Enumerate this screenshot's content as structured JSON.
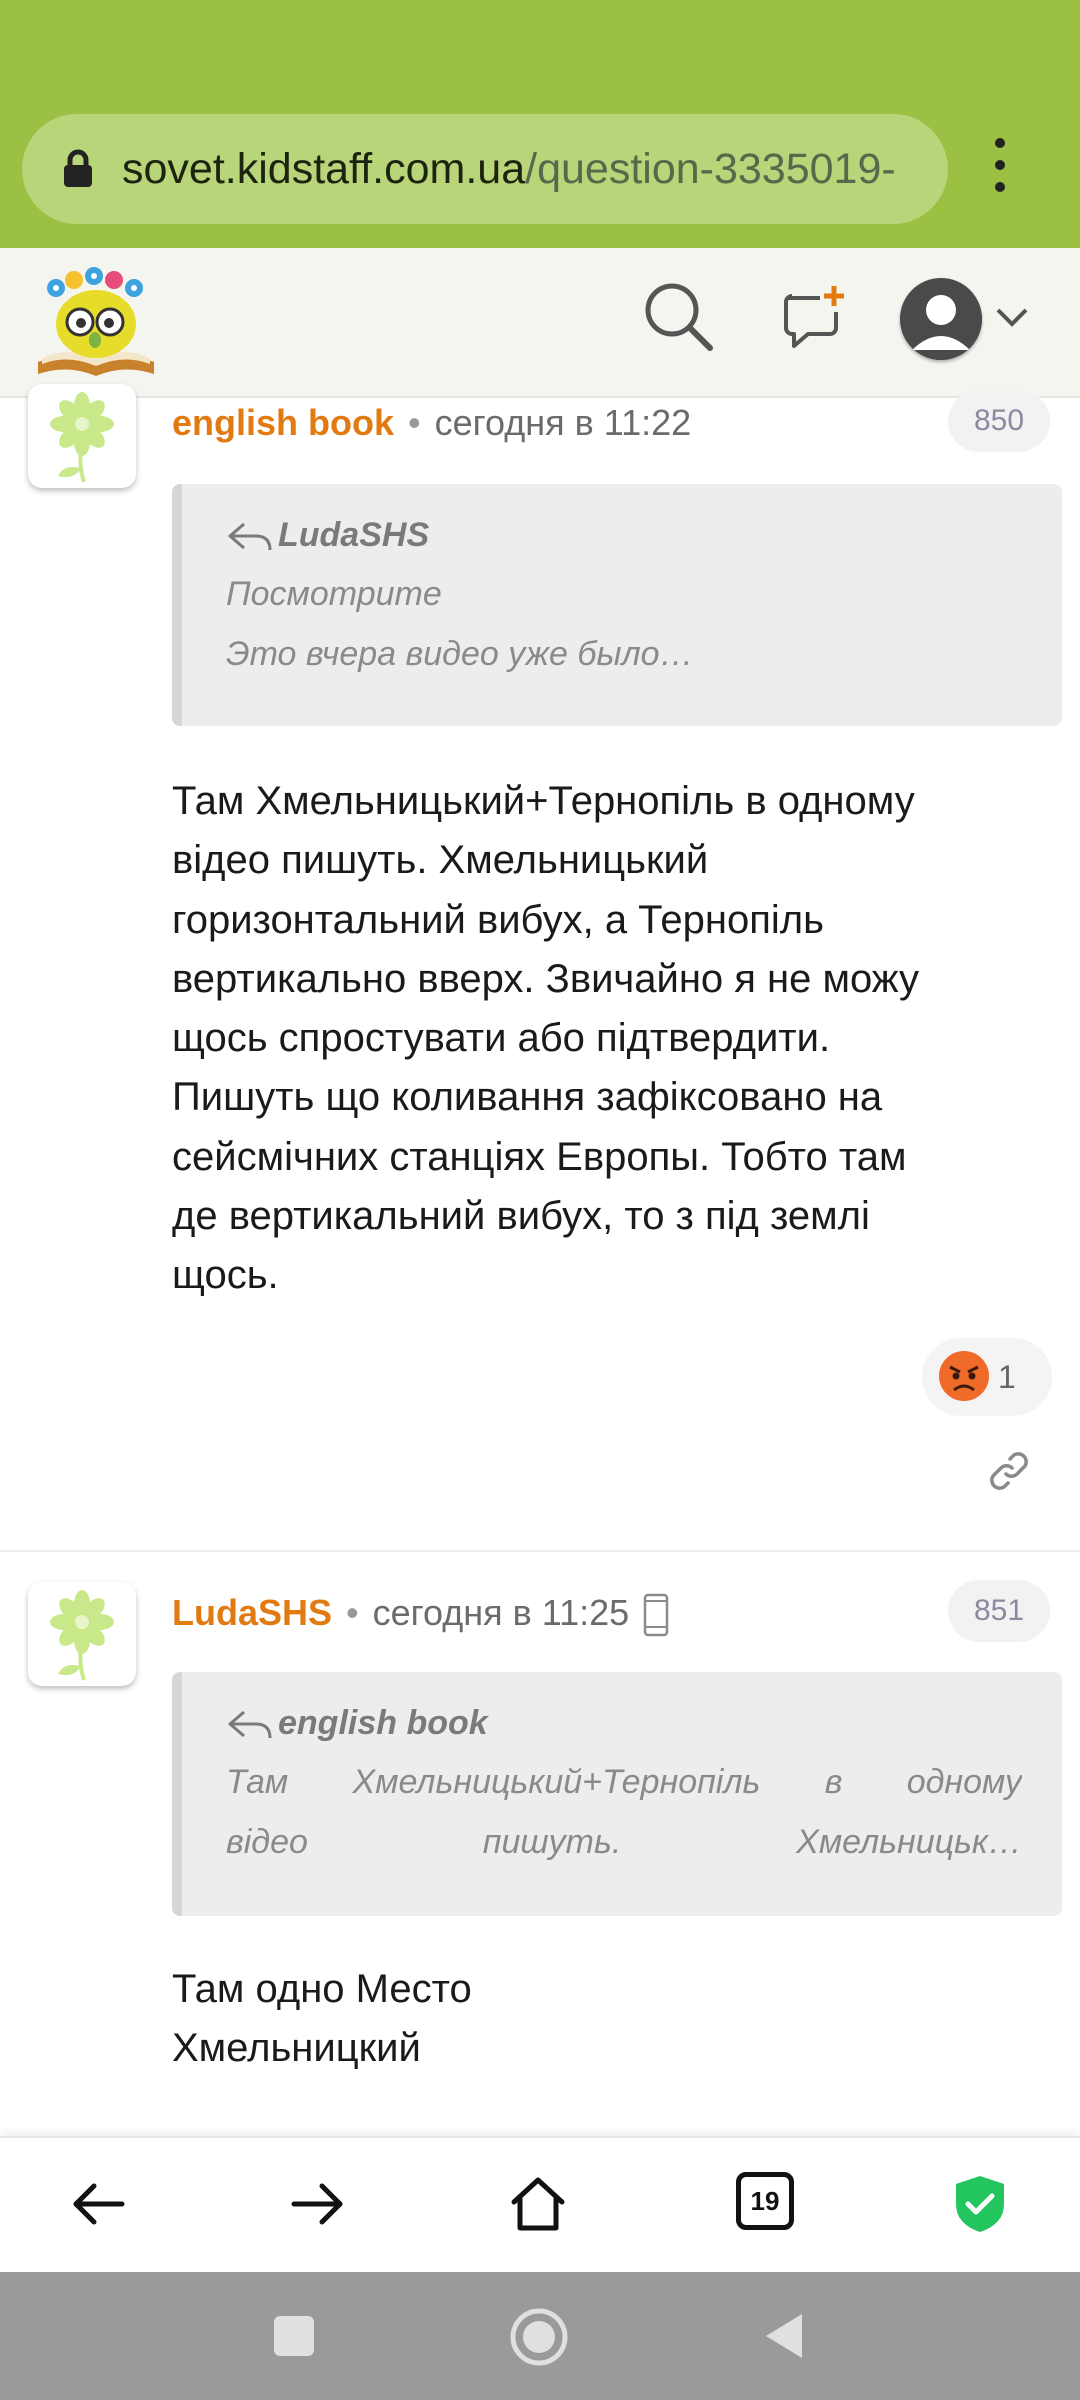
{
  "browser": {
    "url_host": "sovet.kidstaff.com.ua",
    "url_path": "/question-3335019-"
  },
  "site_header": {
    "logo_icon": "kidstaff-logo",
    "search_icon": "search-icon",
    "new_message_icon": "new-message-icon",
    "avatar_icon": "user-avatar-icon"
  },
  "posts": [
    {
      "author": "english book",
      "time": "сегодня в 11:22",
      "number": "850",
      "quote": {
        "author": "LudaSHS",
        "lines": [
          "Посмотрите",
          "Это вчера видео уже было…"
        ]
      },
      "body_lines": [
        "Там Хмельницький+Тернопіль в одному",
        "відео пишуть. Хмельницький",
        "горизонтальний вибух, а Тернопіль",
        "вертикально вверх. Звичайно я не можу",
        "щось спростувати або підтвердити.",
        "Пишуть що коливання зафіксовано на",
        "сейсмічних станціях Европы. Тобто там",
        "де вертикальний вибух, то з під землі",
        "щось."
      ],
      "reaction": {
        "emoji": "angry-face",
        "count": "1"
      }
    },
    {
      "author": "LudaSHS",
      "time": "сегодня в 11:25",
      "number": "851",
      "quote": {
        "author": "english book",
        "line1_words": [
          "Там",
          "Хмельницький+Тернопіль",
          "в",
          "одному"
        ],
        "line2_words": [
          "відео",
          "пишуть.",
          "Хмельницьк…"
        ]
      },
      "body_lines": [
        "Там одно Место",
        "Хмельницкий"
      ]
    }
  ],
  "bottom_nav": {
    "tabs_count": "19"
  },
  "colors": {
    "browser_bar": "#9bc043",
    "author": "#e27a12",
    "shield": "#22c55e"
  }
}
